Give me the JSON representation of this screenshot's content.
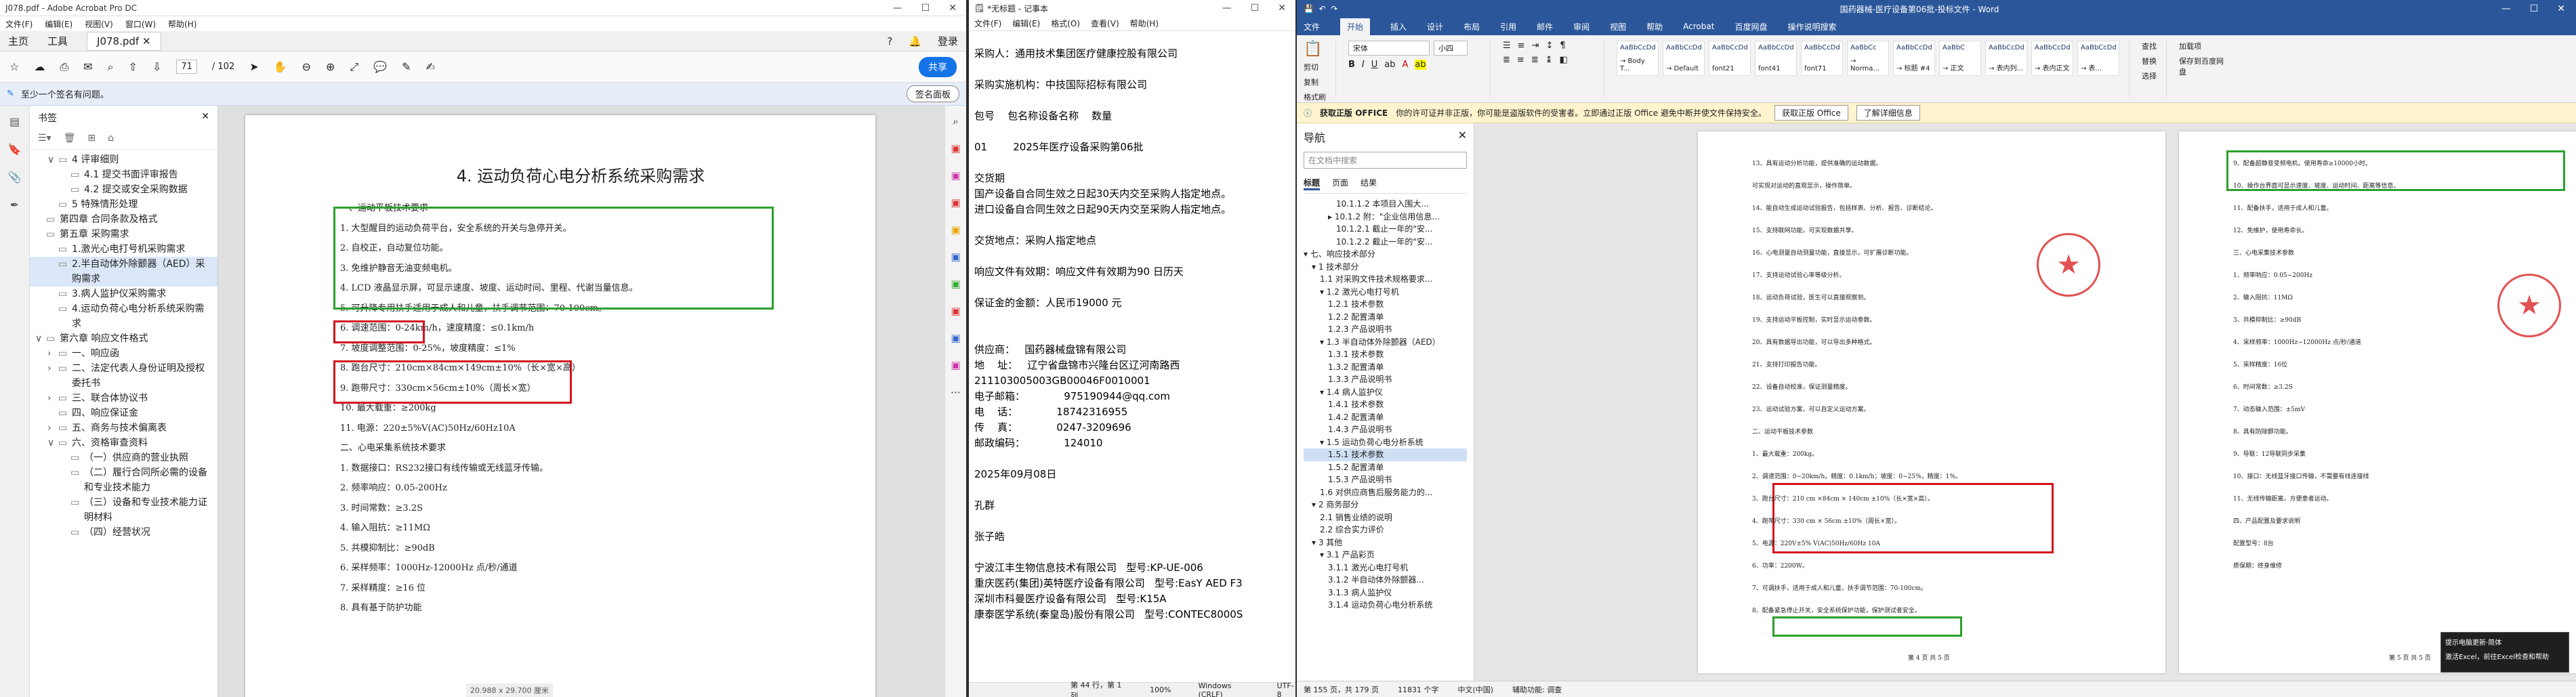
{
  "acrobat": {
    "window_title": "J078.pdf - Adobe Acrobat Pro DC",
    "menu": [
      "文件(F)",
      "编辑(E)",
      "视图(V)",
      "窗口(W)",
      "帮助(H)"
    ],
    "tabs": [
      "主页",
      "工具",
      "J078.pdf"
    ],
    "signin": "登录",
    "page_num": "71",
    "page_total": "/ 102",
    "share": "共享",
    "notice": "至少一个签名有问题。",
    "sign_panel": "签名面板",
    "bookmarks_title": "书签",
    "bookmarks": [
      {
        "label": "4 评审细则",
        "car": "∨",
        "indent": 1,
        "sel": false
      },
      {
        "label": "4.1 提交书面评审报告",
        "car": "",
        "indent": 2,
        "sel": false
      },
      {
        "label": "4.2 提交或安全采购数据",
        "car": "",
        "indent": 2,
        "sel": false
      },
      {
        "label": "5 特殊情形处理",
        "car": "",
        "indent": 1,
        "sel": false
      },
      {
        "label": "第四章 合同条款及格式",
        "car": "",
        "indent": 0,
        "sel": false
      },
      {
        "label": "第五章 采购需求",
        "car": "",
        "indent": 0,
        "sel": false
      },
      {
        "label": "1.激光心电打号机采购需求",
        "car": "",
        "indent": 1,
        "sel": false
      },
      {
        "label": "2.半自动体外除颤器（AED）采购需求",
        "car": "",
        "indent": 1,
        "sel": true
      },
      {
        "label": "3.病人监护仪采购需求",
        "car": "",
        "indent": 1,
        "sel": false
      },
      {
        "label": "4.运动负荷心电分析系统采购需求",
        "car": "",
        "indent": 1,
        "sel": false
      },
      {
        "label": "第六章 响应文件格式",
        "car": "∨",
        "indent": 0,
        "sel": false
      },
      {
        "label": "一、响应函",
        "car": "›",
        "indent": 1,
        "sel": false
      },
      {
        "label": "二、法定代表人身份证明及授权委托书",
        "car": "›",
        "indent": 1,
        "sel": false
      },
      {
        "label": "三、联合体协议书",
        "car": "›",
        "indent": 1,
        "sel": false
      },
      {
        "label": "四、响应保证金",
        "car": "",
        "indent": 1,
        "sel": false
      },
      {
        "label": "五、商务与技术偏离表",
        "car": "›",
        "indent": 1,
        "sel": false
      },
      {
        "label": "六、资格审查资料",
        "car": "∨",
        "indent": 1,
        "sel": false
      },
      {
        "label": "（一）供应商的营业执照",
        "car": "",
        "indent": 2,
        "sel": false
      },
      {
        "label": "（二）履行合同所必需的设备和专业技术能力",
        "car": "",
        "indent": 2,
        "sel": false
      },
      {
        "label": "（三）设备和专业技术能力证明材料",
        "car": "",
        "indent": 2,
        "sel": false
      },
      {
        "label": "（四）经营状况",
        "car": "",
        "indent": 2,
        "sel": false
      }
    ],
    "page_heading": "4. 运动负荷心电分析系统采购需求",
    "page_lines": [
      "一、运动平板技术要求",
      "1. 大型醒目的运动负荷平台，安全系统的开关与急停开关。",
      "2. 自校正，自动复位功能。",
      "3. 免维护静音无油变频电机。",
      "4. LCD 液晶显示屏，可显示速度、坡度、运动时间、里程、代谢当量信息。",
      "5. 可升降专用扶手适用于成人和儿童，扶手调节范围：70-100cm。",
      "6. 调速范围：0-24km/h，速度精度：≤0.1km/h",
      "7. 坡度调整范围：0-25%，坡度精度：≤1%",
      "8. 跑台尺寸：210cm×84cm×149cm±10%（长×宽×高）",
      "9. 跑带尺寸：330cm×56cm±10%（周长×宽）",
      "10. 最大载重：≥200kg",
      "11. 电源：220±5%V(AC)50Hz/60Hz10A",
      "二、心电采集系统技术要求",
      "1. 数据接口：RS232接口有线传输或无线蓝牙传输。",
      "2. 频率响应：0.05-200Hz",
      "3. 时间常数：≥3.2S",
      "4. 输入阻抗：≥11MΩ",
      "5. 共模抑制比：≥90dB",
      "6. 采样频率：1000Hz-12000Hz 点/秒/通道",
      "7. 采样精度：≥16 位",
      "8. 具有基于防护功能"
    ],
    "status": "20.988 x 29.700 厘米"
  },
  "notepad": {
    "window_title": "*无标题 - 记事本",
    "menu": [
      "文件(F)",
      "编辑(E)",
      "格式(O)",
      "查看(V)",
      "帮助(H)"
    ],
    "text": "采购人：通用技术集团医疗健康控股有限公司\n\n采购实施机构：中技国际招标有限公司\n\n包号    包名称设备名称    数量\n\n01        2025年医疗设备采购第06批\n\n交货期\n国产设备自合同生效之日起30天内交至采购人指定地点。\n进口设备自合同生效之日起90天内交至采购人指定地点。\n\n交货地点：采购人指定地点\n\n响应文件有效期：响应文件有效期为90 日历天\n\n保证金的金额：人民币19000 元\n\n\n供应商：   国药器械盘锦有限公司\n地    址：   辽宁省盘锦市兴隆台区辽河南路西\n211103005003GB00046F0010001\n电子邮箱：            975190944@qq.com\n电    话：            18742316955\n传    真：            0247-3209696\n邮政编码：            124010\n\n2025年09月08日\n\n孔群\n\n张子皓\n\n宁波江丰生物信息技术有限公司   型号:KP-UE-006\n重庆医药(集团)英特医疗设备有限公司   型号:EasY AED F3\n深圳市科曼医疗设备有限公司   型号:K15A\n康泰医学系统(秦皇岛)股份有限公司   型号:CONTEC8000S",
    "status": [
      "第 44 行，第 1 列",
      "100%",
      "Windows (CRLF)",
      "UTF-8"
    ]
  },
  "word": {
    "window_title": "国药器械-医疗设备第06批-投标文件 - Word",
    "tabs": [
      "文件",
      "开始",
      "插入",
      "设计",
      "布局",
      "引用",
      "邮件",
      "审阅",
      "视图",
      "帮助",
      "Acrobat",
      "百度网盘",
      "操作说明搜索"
    ],
    "active_tab": "开始",
    "clipboard": [
      "剪切",
      "复制",
      "格式刷"
    ],
    "font_name": "宋体",
    "font_size": "小四",
    "styles": [
      {
        "preview": "AaBbCcDd",
        "name": "→ Body T..."
      },
      {
        "preview": "AaBbCcDd",
        "name": "→ Default"
      },
      {
        "preview": "AaBbCcDd",
        "name": "font21"
      },
      {
        "preview": "AaBbCcDd",
        "name": "font41"
      },
      {
        "preview": "AaBbCcDd",
        "name": "font71"
      },
      {
        "preview": "AaBbCc",
        "name": "→ Norma..."
      },
      {
        "preview": "AaBbCcDd",
        "name": "→ 标题 #4"
      },
      {
        "preview": "AaBbC",
        "name": "→ 正文"
      },
      {
        "preview": "AaBbCcDd",
        "name": "→ 表内列..."
      },
      {
        "preview": "AaBbCcDd",
        "name": "→ 表内正文"
      },
      {
        "preview": "AaBbCcDd",
        "name": "→ 表..."
      }
    ],
    "editing": [
      "查找",
      "替换",
      "选择"
    ],
    "extra_buttons": [
      "加载项",
      "保存到百度网盘"
    ],
    "msg_label": "获取正版 OFFICE",
    "msg_text": "你的许可证并非正版，你可能是盗版软件的受害者。立即通过正版 Office 避免中断并使文件保持安全。",
    "msg_btn1": "获取正版 Office",
    "msg_btn2": "了解详细信息",
    "nav_title": "导航",
    "nav_search": "在文档中搜索",
    "nav_tabs": [
      "标题",
      "页面",
      "结果"
    ],
    "nav_items": [
      {
        "label": "10.1.1.2 本项目入围大...",
        "indent": 4,
        "sel": false
      },
      {
        "label": "▸ 10.1.2 附：\"企业信用信息...",
        "indent": 3,
        "sel": false
      },
      {
        "label": "10.1.2.1 截止一年的\"安...",
        "indent": 4,
        "sel": false
      },
      {
        "label": "10.1.2.2 截止一年的\"安...",
        "indent": 4,
        "sel": false
      },
      {
        "label": "▾ 七、响应技术部分",
        "indent": 0,
        "sel": false
      },
      {
        "label": "▾ 1 技术部分",
        "indent": 1,
        "sel": false
      },
      {
        "label": "1.1 对采购文件技术规格要求...",
        "indent": 2,
        "sel": false
      },
      {
        "label": "▾ 1.2 激光心电打号机",
        "indent": 2,
        "sel": false
      },
      {
        "label": "1.2.1 技术参数",
        "indent": 3,
        "sel": false
      },
      {
        "label": "1.2.2 配置清单",
        "indent": 3,
        "sel": false
      },
      {
        "label": "1.2.3 产品说明书",
        "indent": 3,
        "sel": false
      },
      {
        "label": "▾ 1.3 半自动体外除颤器（AED）",
        "indent": 2,
        "sel": false
      },
      {
        "label": "1.3.1 技术参数",
        "indent": 3,
        "sel": false
      },
      {
        "label": "1.3.2 配置清单",
        "indent": 3,
        "sel": false
      },
      {
        "label": "1.3.3 产品说明书",
        "indent": 3,
        "sel": false
      },
      {
        "label": "▾ 1.4 病人监护仪",
        "indent": 2,
        "sel": false
      },
      {
        "label": "1.4.1 技术参数",
        "indent": 3,
        "sel": false
      },
      {
        "label": "1.4.2 配置清单",
        "indent": 3,
        "sel": false
      },
      {
        "label": "1.4.3 产品说明书",
        "indent": 3,
        "sel": false
      },
      {
        "label": "▾ 1.5 运动负荷心电分析系统",
        "indent": 2,
        "sel": false
      },
      {
        "label": "1.5.1 技术参数",
        "indent": 3,
        "sel": true
      },
      {
        "label": "1.5.2 配置清单",
        "indent": 3,
        "sel": false
      },
      {
        "label": "1.5.3 产品说明书",
        "indent": 3,
        "sel": false
      },
      {
        "label": "1.6 对供应商售后服务能力的...",
        "indent": 2,
        "sel": false
      },
      {
        "label": "▾ 2 商务部分",
        "indent": 1,
        "sel": false
      },
      {
        "label": "2.1 销售业绩的说明",
        "indent": 2,
        "sel": false
      },
      {
        "label": "2.2 综合实力评价",
        "indent": 2,
        "sel": false
      },
      {
        "label": "▾ 3 其他",
        "indent": 1,
        "sel": false
      },
      {
        "label": "▾ 3.1 产品彩页",
        "indent": 2,
        "sel": false
      },
      {
        "label": "3.1.1 激光心电打号机",
        "indent": 3,
        "sel": false
      },
      {
        "label": "3.1.2 半自动体外除颤器...",
        "indent": 3,
        "sel": false
      },
      {
        "label": "3.1.3 病人监护仪",
        "indent": 3,
        "sel": false
      },
      {
        "label": "3.1.4 运动负荷心电分析系统",
        "indent": 3,
        "sel": false
      }
    ],
    "page1_lines": [
      "13、具有运动分析功能，提供准确的运动数据。",
      "可实现对运动的直观显示，操作简单。",
      "14、能自动生成运动试验报告，包括样表、分析、报告、诊断结论。",
      "15、支持联网功能，可实现数据共享。",
      "16、心电测量自动测量功能，直接显示，可扩展诊断功能。",
      "17、支持运动试验心率等级分析。",
      "18、运动负荷试验，医生可以直接观察到。",
      "19、支持运动平板控制，实时显示运动参数。",
      "20、具有数据导出功能，可以导出多种格式。",
      "21、支持打印报告功能。",
      "22、设备自动校准，保证测量精度。",
      "23、运动试验方案，可以自定义运动方案。",
      "二、运动平板技术参数",
      "1、最大载重：200kg。",
      "2、调速范围：0~20km/h，精度：0.1km/h；坡度：0~25%，精度：1%。",
      "3、跑台尺寸：210 cm ×84cm × 140cm ±10%（长×宽×高）。",
      "4、跑带尺寸：330 cm × 56cm ±10%（周长×宽）。",
      "5、电源：220V±5% V(AC)50Hz/60Hz 10A",
      "6、功率：2200W。",
      "7、可调扶手，适用于成人和儿童，扶手调节范围：70-100cm。",
      "8、配备紧急停止开关，安全系统保护功能，保护测试者安全。"
    ],
    "page1_footer": "第 4 页 共 5 页",
    "page2_lines": [
      "9、配备超静音变频电机，使用寿命≥10000小时。",
      "10、操作台界面可显示速度、坡度、运动时间、距离等信息。",
      "11、配备扶手，适用于成人和儿童。",
      "12、免维护，使用寿命长。",
      "三、心电采集技术参数",
      "1、频率响应：0.05~200Hz",
      "2、输入阻抗：11MΩ",
      "3、共模抑制比：≥90dB",
      "4、采样频率：1000Hz~12000Hz 点/秒/通道",
      "5、采样精度：16位",
      "6、时间常数：≥3.2S",
      "7、动态输入范围：±5mV",
      "8、具有防除颤功能。",
      "9、导联：12导联同步采集",
      "10、接口：无线蓝牙接口传输，不需要有线连接线",
      "11、无线传输距离，方便患者运动。",
      "四、产品配置及要求说明",
      "配置型号：8台",
      "质保期：终身维修"
    ],
    "page2_footer": "第 5 页 共 5 页",
    "status": [
      "第 155 页，共 179 页",
      "11831 个字",
      "中文(中国)",
      "辅助功能: 调查"
    ],
    "toast_title": "提示电脑更新·简体",
    "toast_body": "激活Excel，前往Excel检查和帮助"
  }
}
